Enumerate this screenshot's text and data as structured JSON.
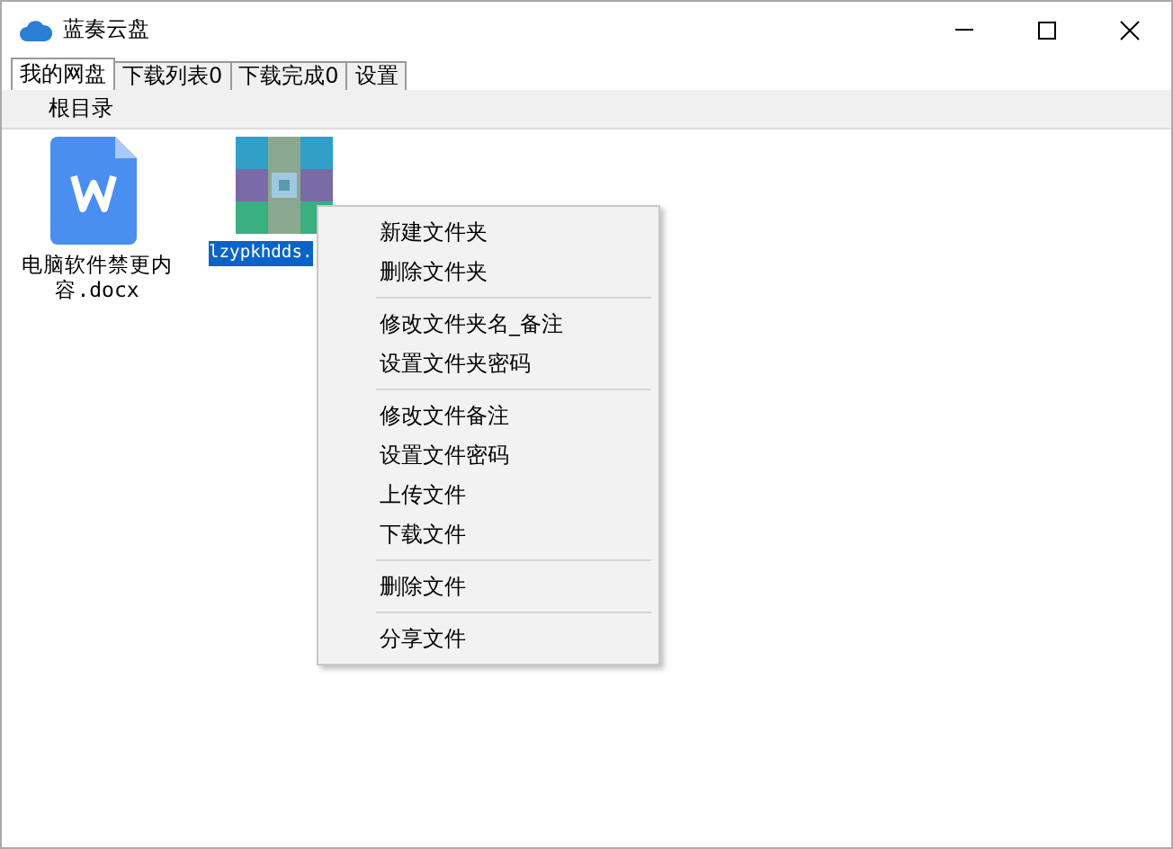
{
  "window": {
    "title": "蓝奏云盘"
  },
  "tabs": [
    {
      "label": "我的网盘",
      "selected": true
    },
    {
      "label": "下载列表0",
      "selected": false
    },
    {
      "label": "下载完成0",
      "selected": false
    },
    {
      "label": "设置",
      "selected": false
    }
  ],
  "path": "根目录",
  "files": [
    {
      "kind": "word",
      "name": "电脑软件禁更内容.docx",
      "selected": false
    },
    {
      "kind": "picture",
      "name": "lzypkhdds.",
      "selected": true
    }
  ],
  "context_menu": {
    "groups": [
      [
        "新建文件夹",
        "删除文件夹"
      ],
      [
        "修改文件夹名_备注",
        "设置文件夹密码"
      ],
      [
        "修改文件备注",
        "设置文件密码",
        "上传文件",
        "下载文件"
      ],
      [
        "删除文件"
      ],
      [
        "分享文件"
      ]
    ]
  }
}
